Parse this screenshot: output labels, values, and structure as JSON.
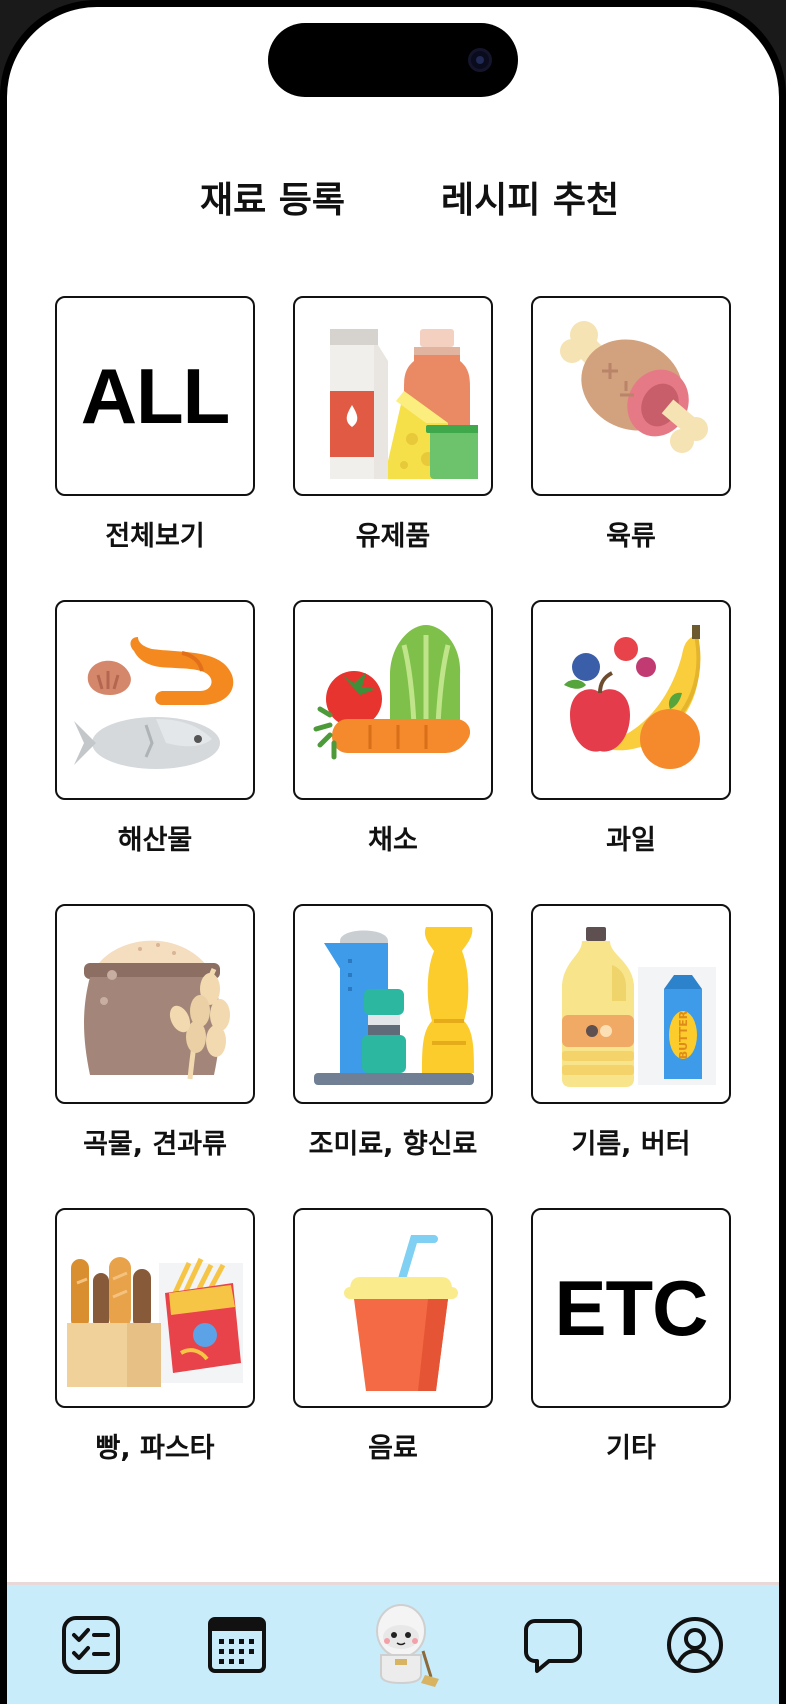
{
  "top_tabs": [
    {
      "label": "재료 등록"
    },
    {
      "label": "레시피 추천"
    }
  ],
  "categories": [
    {
      "label": "전체보기",
      "tile_text": "ALL",
      "icon": "all-text-icon"
    },
    {
      "label": "유제품",
      "icon": "dairy-icon"
    },
    {
      "label": "육류",
      "icon": "meat-icon"
    },
    {
      "label": "해산물",
      "icon": "seafood-icon"
    },
    {
      "label": "채소",
      "icon": "vegetable-icon"
    },
    {
      "label": "과일",
      "icon": "fruit-icon"
    },
    {
      "label": "곡물, 견과류",
      "icon": "grain-icon"
    },
    {
      "label": "조미료, 향신료",
      "icon": "seasoning-icon"
    },
    {
      "label": "기름, 버터",
      "icon": "oil-butter-icon"
    },
    {
      "label": "빵, 파스타",
      "icon": "bread-pasta-icon"
    },
    {
      "label": "음료",
      "icon": "drink-icon"
    },
    {
      "label": "기타",
      "tile_text": "ETC",
      "icon": "etc-text-icon"
    }
  ],
  "bottom_nav": [
    {
      "icon": "checklist-icon"
    },
    {
      "icon": "calendar-icon"
    },
    {
      "icon": "robot-mascot-icon"
    },
    {
      "icon": "chat-bubble-icon"
    },
    {
      "icon": "profile-icon"
    }
  ],
  "colors": {
    "bottom_bar": "#c9ecfb",
    "tile_border": "#111111",
    "text": "#111111"
  }
}
